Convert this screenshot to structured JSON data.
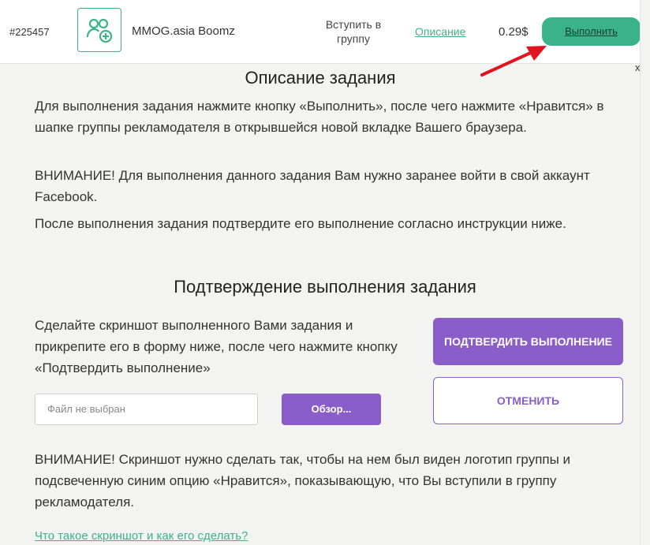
{
  "task": {
    "id": "#225457",
    "icon": "add-user-icon",
    "name": "MMOG.asia Boomz",
    "type": "Вступить в группу",
    "description_link": "Описание",
    "price": "0.29$",
    "execute_label": "Выполнить",
    "close_label": "x"
  },
  "description": {
    "title": "Описание задания",
    "paragraphs": [
      "Для выполнения задания нажмите кнопку «Выполнить», после чего нажмите «Нравится» в шапке группы рекламодателя в открывшейся новой вкладке Вашего браузера.",
      "ВНИМАНИЕ! Для выполнения данного задания Вам нужно заранее войти в свой аккаунт Facebook.",
      "После выполнения задания подтвердите его выполнение согласно инструкции ниже."
    ]
  },
  "confirmation": {
    "title": "Подтверждение выполнения задания",
    "instruction": "Сделайте скриншот выполненного Вами задания и прикрепите его в форму ниже, после чего нажмите кнопку «Подтвердить выполнение»",
    "confirm_label": "ПОДТВЕРДИТЬ ВЫПОЛНЕНИЕ",
    "cancel_label": "ОТМЕНИТЬ",
    "file_placeholder": "Файл не выбран",
    "browse_label": "Обзор...",
    "warning": "ВНИМАНИЕ! Скриншот нужно сделать так, чтобы на нем был виден логотип группы и подсвеченную синим опцию «Нравится», показывающую, что Вы вступили в группу рекламодателя.",
    "help_link": "Что такое скриншот и как его сделать?"
  },
  "colors": {
    "accent_green": "#3bb38a",
    "accent_purple": "#8a5ec9",
    "arrow_red": "#e0141e"
  }
}
